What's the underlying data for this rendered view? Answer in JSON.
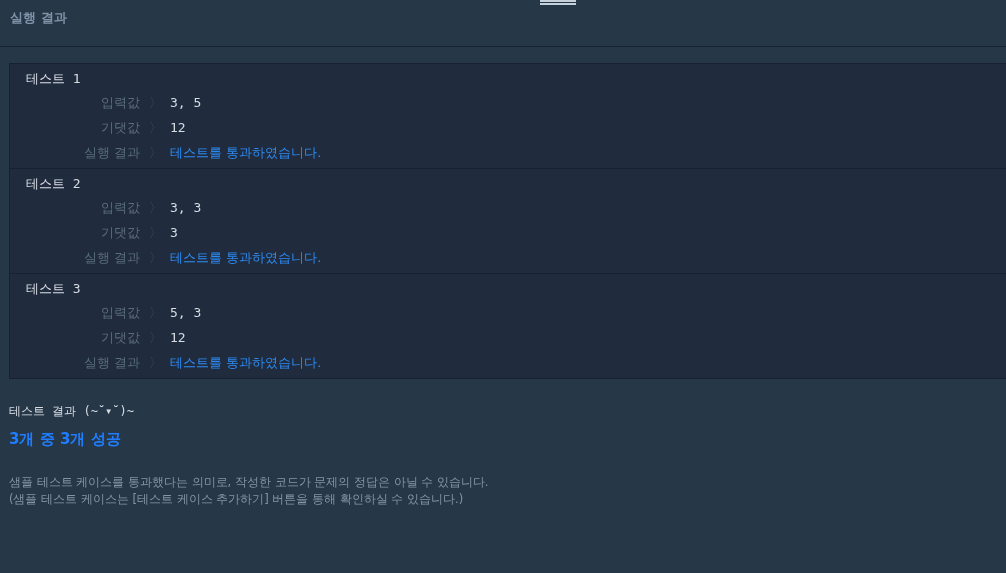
{
  "header": {
    "title": "실행 결과"
  },
  "tests": [
    {
      "title": "테스트 1",
      "rows": [
        {
          "kind": "input",
          "label": "입력값",
          "separator": "〉",
          "value": "3, 5"
        },
        {
          "kind": "expected",
          "label": "기댓값",
          "separator": "〉",
          "value": "12"
        },
        {
          "kind": "result",
          "label": "실행 결과",
          "separator": "〉",
          "value": "테스트를 통과하였습니다."
        }
      ]
    },
    {
      "title": "테스트 2",
      "rows": [
        {
          "kind": "input",
          "label": "입력값",
          "separator": "〉",
          "value": "3, 3"
        },
        {
          "kind": "expected",
          "label": "기댓값",
          "separator": "〉",
          "value": "3"
        },
        {
          "kind": "result",
          "label": "실행 결과",
          "separator": "〉",
          "value": "테스트를 통과하였습니다."
        }
      ]
    },
    {
      "title": "테스트 3",
      "rows": [
        {
          "kind": "input",
          "label": "입력값",
          "separator": "〉",
          "value": "5, 3"
        },
        {
          "kind": "expected",
          "label": "기댓값",
          "separator": "〉",
          "value": "12"
        },
        {
          "kind": "result",
          "label": "실행 결과",
          "separator": "〉",
          "value": "테스트를 통과하였습니다."
        }
      ]
    }
  ],
  "summary": {
    "heading": "테스트 결과 (~˘▾˘)~",
    "score": "3개 중 3개 성공",
    "notes": [
      "샘플 테스트 케이스를 통과했다는 의미로, 작성한 코드가 문제의 정답은 아닐 수 있습니다.",
      "(샘플 테스트 케이스는 [테스트 케이스 추가하기] 버튼을 통해 확인하실 수 있습니다.)"
    ]
  }
}
